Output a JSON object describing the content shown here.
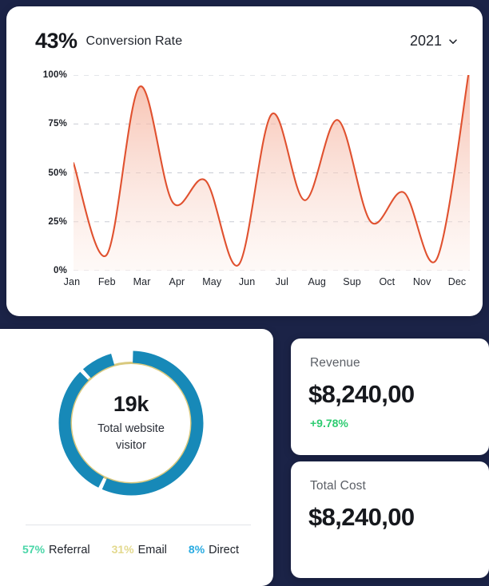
{
  "theme": {
    "background": "#1b2347",
    "card_bg": "#ffffff",
    "line_color": "#e0512f",
    "area_fill": "#f8cfc2",
    "grid_color": "#c9ccd4",
    "donut_blue": "#1789b8",
    "donut_gold": "#d9c97e",
    "legend_teal": "#4ad6a8",
    "legend_gold": "#e3d98e",
    "legend_blue": "#29abe2",
    "positive_green": "#2ecc71"
  },
  "conversion": {
    "percent": "43%",
    "title": "Conversion Rate",
    "year": "2021",
    "chevron_icon": "chevron-down-icon"
  },
  "chart_data": {
    "type": "area",
    "title": "Conversion Rate",
    "xlabel": "",
    "ylabel": "",
    "ylim": [
      0,
      100
    ],
    "grid": true,
    "legend_position": "none",
    "line_color": "#e0512f",
    "categories": [
      "Jan",
      "Feb",
      "Mar",
      "Apr",
      "May",
      "Jun",
      "Jul",
      "Aug",
      "Sup",
      "Oct",
      "Nov",
      "Dec"
    ],
    "tick_labels_y": [
      "0%",
      "25%",
      "50%",
      "75%",
      "100%"
    ],
    "series": [
      {
        "name": "Conversion Rate",
        "values": [
          55,
          8,
          94,
          35,
          46,
          3,
          80,
          36,
          77,
          25,
          40,
          6,
          105
        ]
      }
    ],
    "note": "Smooth spline through monthly values; starts at ~55% mid-January, final Dec point rises off the top of the plot."
  },
  "visitors": {
    "value": "19k",
    "label": "Total website\nvisitor",
    "label_line1": "Total website",
    "label_line2": "visitor",
    "donut": {
      "type": "donut",
      "segments": [
        {
          "name": "Referral",
          "percent": 57,
          "color": "#1789b8"
        },
        {
          "name": "Email",
          "percent": 31,
          "color": "#1789b8"
        },
        {
          "name": "Direct",
          "percent": 8,
          "color": "#1789b8"
        }
      ],
      "inner_ring_color": "#d9c97e"
    },
    "legend": [
      {
        "pct": "57%",
        "name": "Referral",
        "color": "#4ad6a8"
      },
      {
        "pct": "31%",
        "name": "Email",
        "color": "#e3d98e"
      },
      {
        "pct": "8%",
        "name": "Direct",
        "color": "#29abe2"
      }
    ]
  },
  "stats": [
    {
      "label": "Revenue",
      "value": "$8,240,00",
      "delta": "+9.78%",
      "delta_color": "#2ecc71"
    },
    {
      "label": "Total Cost",
      "value": "$8,240,00",
      "delta": "",
      "delta_color": ""
    }
  ]
}
